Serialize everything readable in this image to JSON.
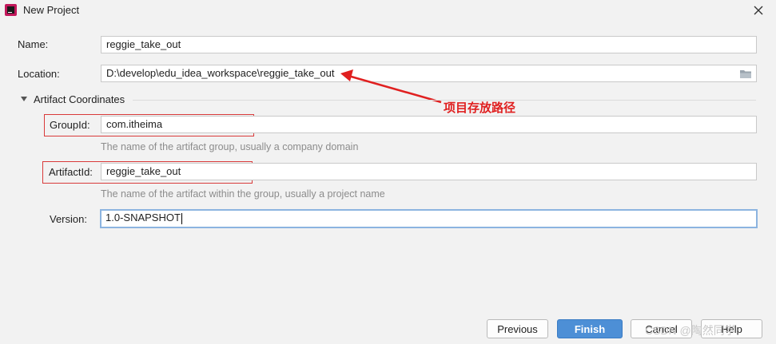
{
  "window": {
    "title": "New Project"
  },
  "form": {
    "name": {
      "label": "Name:",
      "value": "reggie_take_out"
    },
    "location": {
      "label": "Location:",
      "value": "D:\\develop\\edu_idea_workspace\\reggie_take_out"
    },
    "section": {
      "label": "Artifact Coordinates"
    },
    "group_id": {
      "label": "GroupId:",
      "value": "com.itheima",
      "hint": "The name of the artifact group, usually a company domain"
    },
    "artifact_id": {
      "label": "ArtifactId:",
      "value": "reggie_take_out",
      "hint": "The name of the artifact within the group, usually a project name"
    },
    "version": {
      "label": "Version:",
      "value": "1.0-SNAPSHOT"
    }
  },
  "annotation": {
    "text": "项目存放路径",
    "color": "#e02020"
  },
  "buttons": {
    "previous": "Previous",
    "finish": "Finish",
    "cancel": "Cancel",
    "help": "Help"
  },
  "watermark": "CSDN @陶然同学",
  "colors": {
    "accent": "#4d8fd6",
    "highlight": "#d93a3a"
  }
}
